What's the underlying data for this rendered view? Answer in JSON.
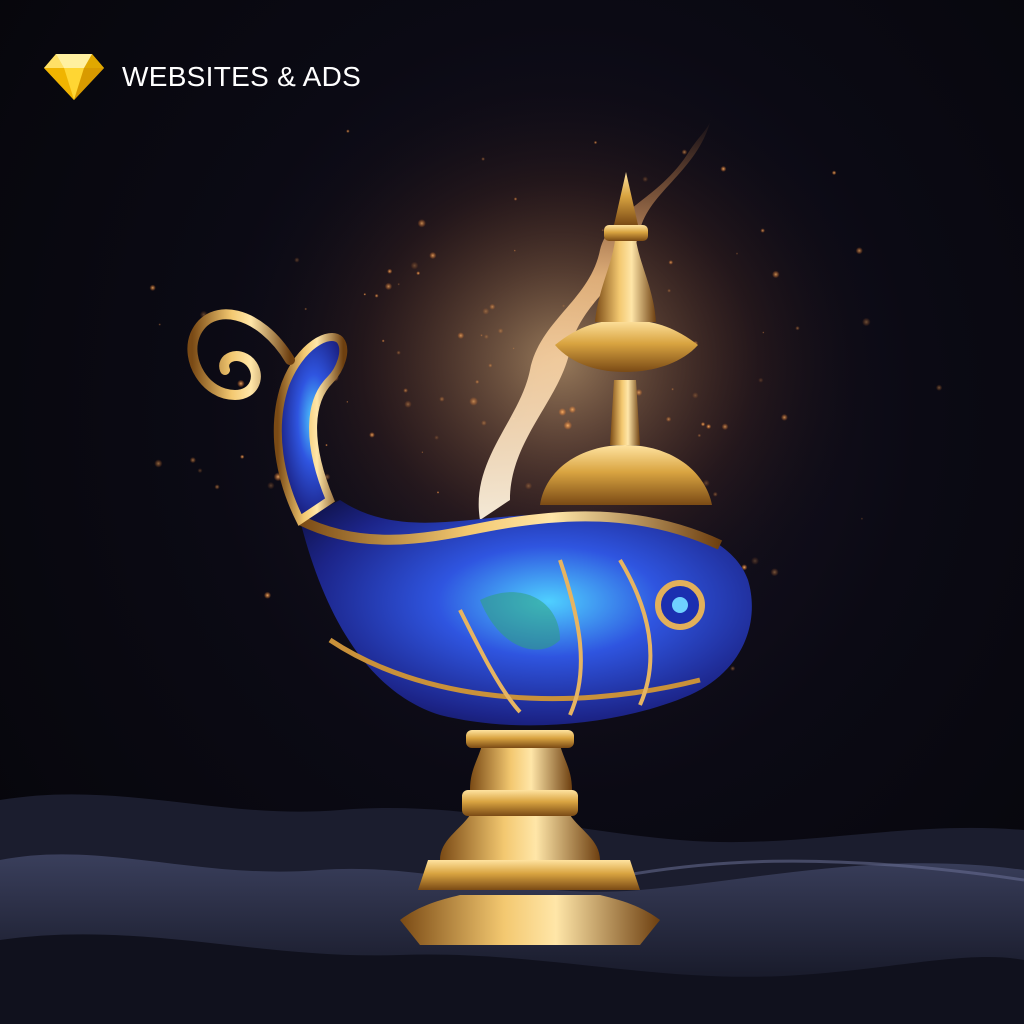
{
  "brand": {
    "name": "WEBSITES & ADS",
    "logo_icon": "diamond-icon",
    "logo_color": "#f5c518"
  },
  "image": {
    "subject": "magic-lamp",
    "palette": {
      "background": "#07070e",
      "gold": "#d9a441",
      "jewel_blue": "#2a3fb8",
      "flame": "#ffd9a8",
      "cloth": "#232638"
    }
  }
}
